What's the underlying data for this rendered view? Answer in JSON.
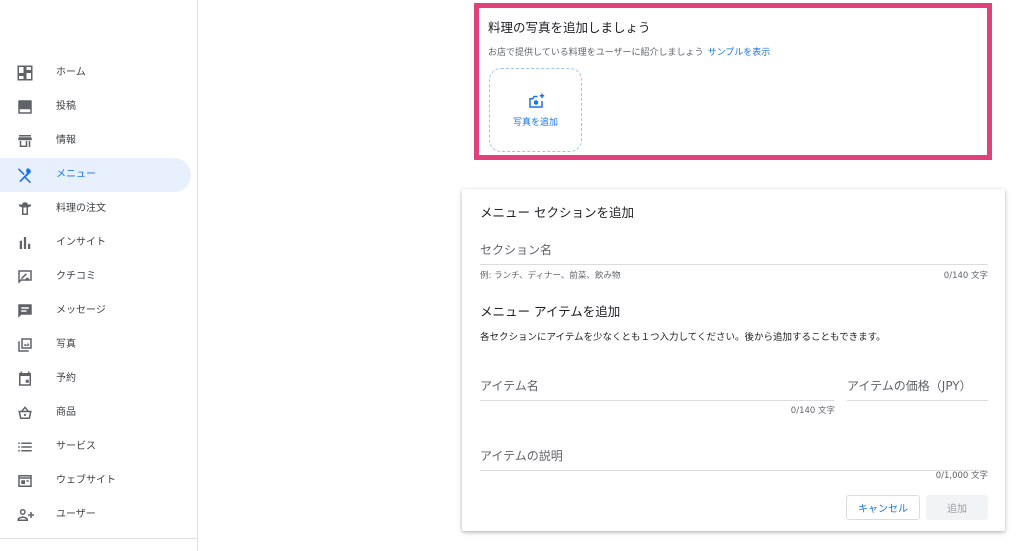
{
  "sidebar": {
    "items": [
      {
        "label": "ホーム",
        "icon": "dashboard-icon"
      },
      {
        "label": "投稿",
        "icon": "post-icon"
      },
      {
        "label": "情報",
        "icon": "storefront-icon"
      },
      {
        "label": "メニュー",
        "icon": "utensils-icon",
        "active": true
      },
      {
        "label": "料理の注文",
        "icon": "food-order-icon"
      },
      {
        "label": "インサイト",
        "icon": "bar-chart-icon"
      },
      {
        "label": "クチコミ",
        "icon": "review-icon"
      },
      {
        "label": "メッセージ",
        "icon": "message-icon"
      },
      {
        "label": "写真",
        "icon": "photo-library-icon"
      },
      {
        "label": "予約",
        "icon": "calendar-icon"
      },
      {
        "label": "商品",
        "icon": "basket-icon"
      },
      {
        "label": "サービス",
        "icon": "list-icon"
      },
      {
        "label": "ウェブサイト",
        "icon": "website-icon"
      },
      {
        "label": "ユーザー",
        "icon": "add-user-icon"
      }
    ]
  },
  "photo_section": {
    "title": "料理の写真を追加しましょう",
    "subtitle": "お店で提供している料理をユーザーに紹介しましょう",
    "sample_link": "サンプルを表示",
    "add_photo_label": "写真を追加"
  },
  "menu_section": {
    "title": "メニュー セクションを追加",
    "section_name_placeholder": "セクション名",
    "section_name_hint": "例: ランチ、ディナー、前菜、飲み物",
    "section_name_counter": "0/140 文字",
    "item_title": "メニュー アイテムを追加",
    "item_instruction": "各セクションにアイテムを少なくとも１つ入力してください。後から追加することもできます。",
    "item_name_placeholder": "アイテム名",
    "item_name_counter": "0/140 文字",
    "item_price_placeholder": "アイテムの価格（JPY）",
    "item_desc_placeholder": "アイテムの説明",
    "item_desc_counter": "0/1,000 文字",
    "cancel_label": "キャンセル",
    "add_label": "追加"
  },
  "colors": {
    "accent": "#1a73e8",
    "highlight": "#e2407a",
    "active_bg": "#e8f0fe"
  }
}
